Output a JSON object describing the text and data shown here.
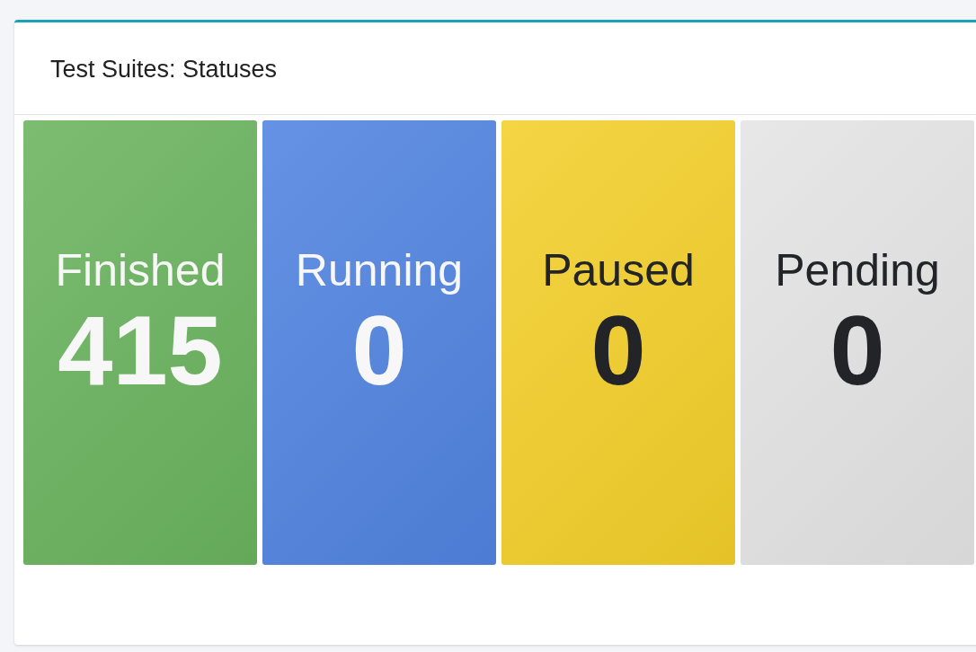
{
  "card": {
    "title": "Test Suites: Statuses"
  },
  "tiles": [
    {
      "label": "Finished",
      "count": "415",
      "color": "#6ab35e"
    },
    {
      "label": "Running",
      "count": "0",
      "color": "#5083e0"
    },
    {
      "label": "Paused",
      "count": "0",
      "color": "#f3cf2a"
    },
    {
      "label": "Pending",
      "count": "0",
      "color": "#e4e4e4"
    }
  ]
}
